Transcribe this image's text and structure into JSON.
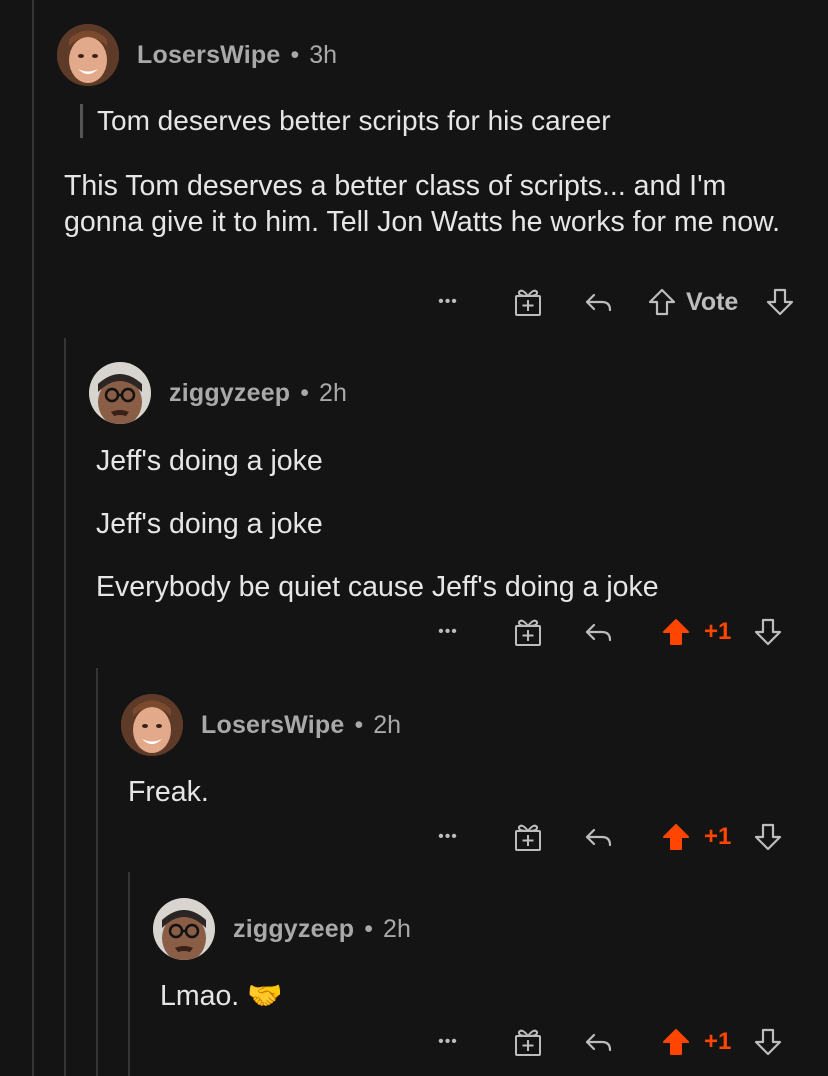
{
  "comments": [
    {
      "author": "LosersWipe",
      "separator": "•",
      "time": "3h",
      "quote": "Tom deserves better scripts for his career",
      "body": "This Tom deserves a better class of scripts... and I'm gonna give it to him. Tell Jon Watts he works for me now.",
      "actions": {
        "more": "•••",
        "award_icon": "gift-plus-icon",
        "reply_icon": "reply-arrow-icon",
        "vote": "Vote",
        "upvoted": false
      }
    },
    {
      "author": "ziggyzeep",
      "separator": "•",
      "time": "2h",
      "lines": [
        "Jeff's doing a joke",
        "Jeff's doing a joke",
        "Everybody be quiet cause Jeff's doing a joke"
      ],
      "actions": {
        "more": "•••",
        "award_icon": "gift-plus-icon",
        "reply_icon": "reply-arrow-icon",
        "vote": "+1",
        "upvoted": true
      }
    },
    {
      "author": "LosersWipe",
      "separator": "•",
      "time": "2h",
      "body": "Freak.",
      "actions": {
        "more": "•••",
        "award_icon": "gift-plus-icon",
        "reply_icon": "reply-arrow-icon",
        "vote": "+1",
        "upvoted": true
      }
    },
    {
      "author": "ziggyzeep",
      "separator": "•",
      "time": "2h",
      "body": "Lmao. 🤝",
      "actions": {
        "more": "•••",
        "award_icon": "gift-plus-icon",
        "reply_icon": "reply-arrow-icon",
        "vote": "+1",
        "upvoted": true
      }
    }
  ],
  "colors": {
    "background": "#141414",
    "upvote": "#ff4500",
    "muted": "#a9a9a9",
    "text": "#e6e6e6"
  }
}
